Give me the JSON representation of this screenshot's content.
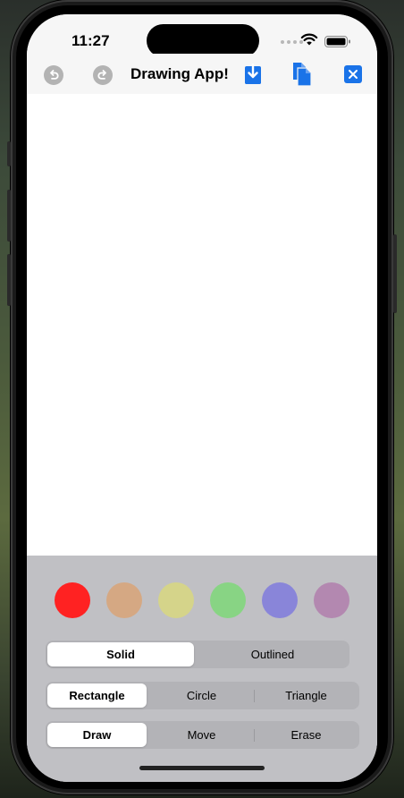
{
  "status_bar": {
    "time": "11:27",
    "icons": [
      "signal-dots-icon",
      "wifi-icon",
      "battery-icon"
    ]
  },
  "toolbar": {
    "title": "Drawing App!",
    "undo_icon": "undo-icon",
    "redo_icon": "redo-icon",
    "save_icon": "download-icon",
    "copy_icon": "copy-icon",
    "clear_icon": "close-icon",
    "accent_color": "#1a73e8",
    "disabled_color": "#b3b3b3"
  },
  "palette": {
    "colors": [
      {
        "name": "red",
        "hex": "#ff2222"
      },
      {
        "name": "tan",
        "hex": "#d5a883"
      },
      {
        "name": "yellow",
        "hex": "#d5d48a"
      },
      {
        "name": "green",
        "hex": "#88d484"
      },
      {
        "name": "purple",
        "hex": "#8985d9"
      },
      {
        "name": "mauve",
        "hex": "#b388b0"
      }
    ]
  },
  "fill_style": {
    "options": [
      "Solid",
      "Outlined"
    ],
    "selected": "Solid"
  },
  "shape": {
    "options": [
      "Rectangle",
      "Circle",
      "Triangle"
    ],
    "selected": "Rectangle"
  },
  "mode": {
    "options": [
      "Draw",
      "Move",
      "Erase"
    ],
    "selected": "Draw"
  }
}
